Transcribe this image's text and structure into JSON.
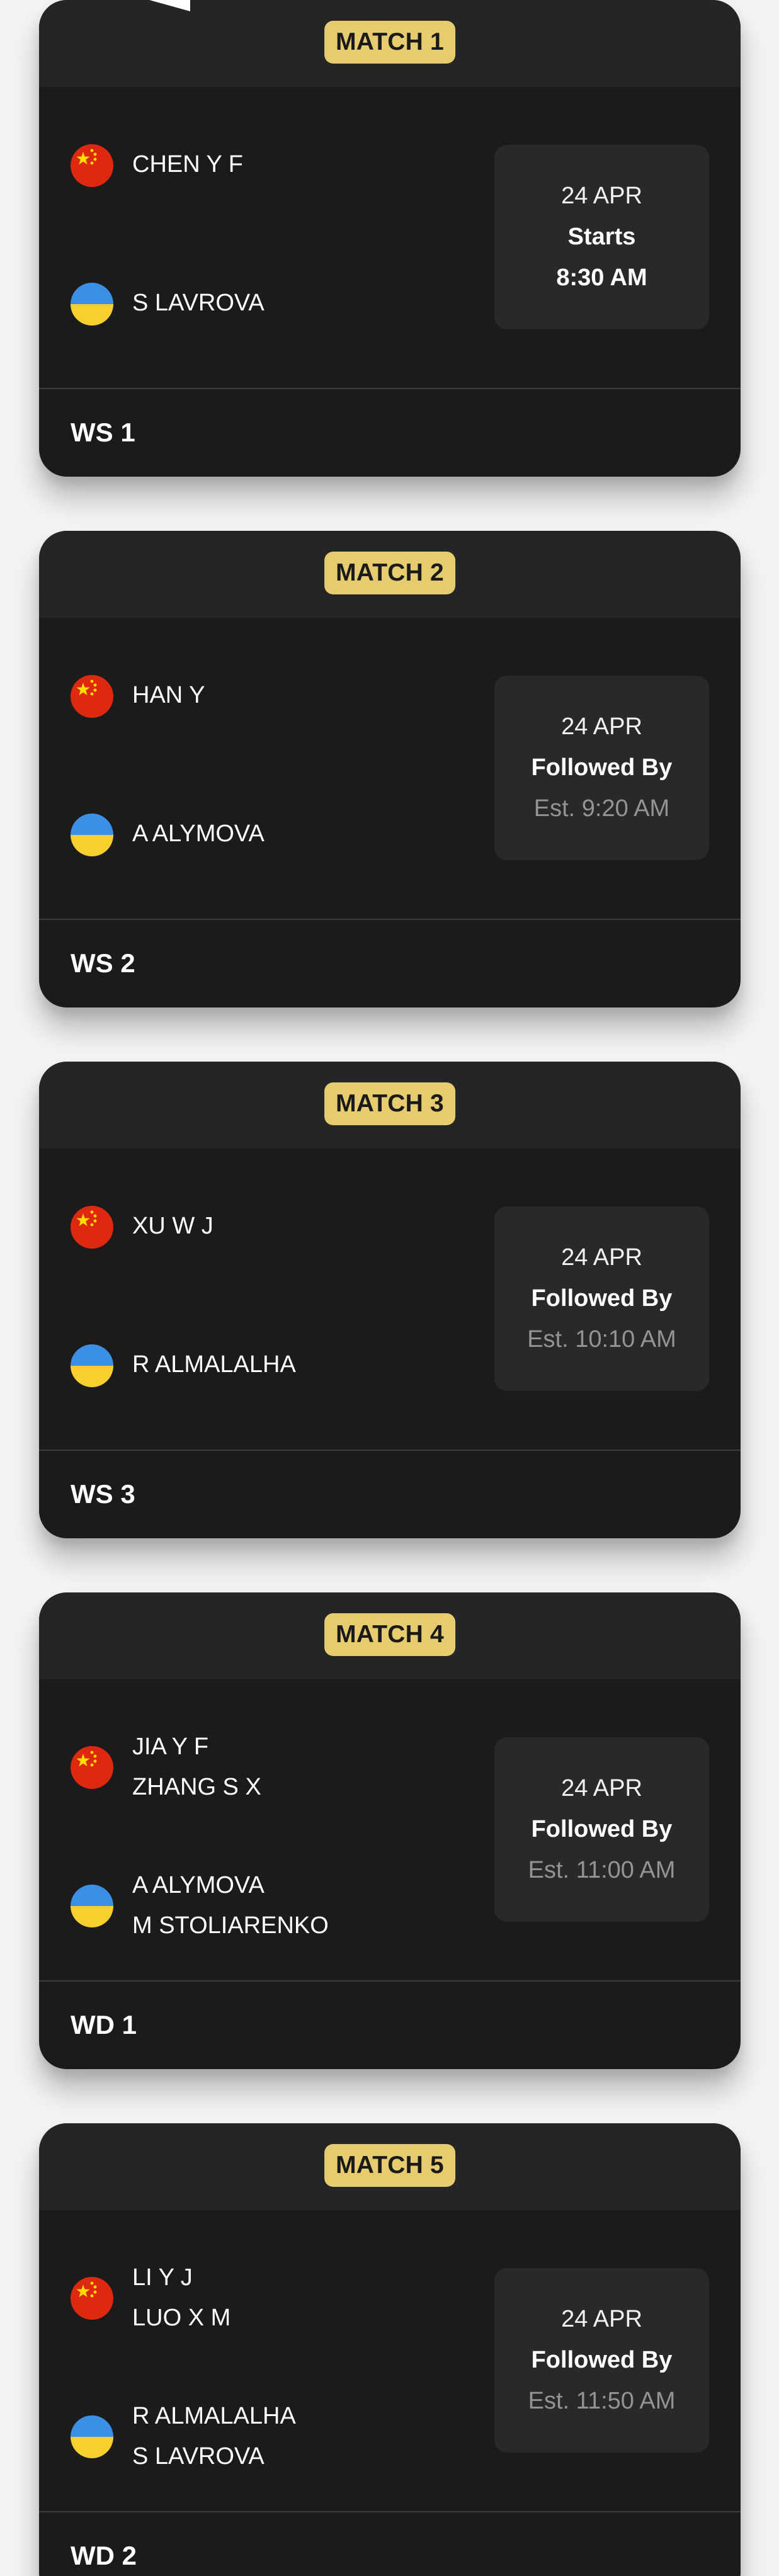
{
  "colors": {
    "card_background": "#1b1b1c",
    "card_header": "#252526",
    "badge": "#e7cc6f",
    "schedule_box": "#29292a",
    "muted_text": "#949494"
  },
  "matches": [
    {
      "label": "MATCH 1",
      "team1": {
        "flag": "china-flag-icon",
        "players": [
          "CHEN Y F"
        ]
      },
      "team2": {
        "flag": "ukraine-flag-icon",
        "players": [
          "S LAVROVA"
        ]
      },
      "date": "24 APR",
      "status": "Starts",
      "time": "8:30 AM",
      "event": "WS 1"
    },
    {
      "label": "MATCH 2",
      "team1": {
        "flag": "china-flag-icon",
        "players": [
          "HAN Y"
        ]
      },
      "team2": {
        "flag": "ukraine-flag-icon",
        "players": [
          "A ALYMOVA"
        ]
      },
      "date": "24 APR",
      "status": "Followed By",
      "time": "Est. 9:20 AM",
      "event": "WS 2"
    },
    {
      "label": "MATCH 3",
      "team1": {
        "flag": "china-flag-icon",
        "players": [
          "XU W J"
        ]
      },
      "team2": {
        "flag": "ukraine-flag-icon",
        "players": [
          "R ALMALALHA"
        ]
      },
      "date": "24 APR",
      "status": "Followed By",
      "time": "Est. 10:10 AM",
      "event": "WS 3"
    },
    {
      "label": "MATCH 4",
      "team1": {
        "flag": "china-flag-icon",
        "players": [
          "JIA Y F",
          "ZHANG S X"
        ]
      },
      "team2": {
        "flag": "ukraine-flag-icon",
        "players": [
          "A ALYMOVA",
          "M STOLIARENKO"
        ]
      },
      "date": "24 APR",
      "status": "Followed By",
      "time": "Est. 11:00 AM",
      "event": "WD 1"
    },
    {
      "label": "MATCH 5",
      "team1": {
        "flag": "china-flag-icon",
        "players": [
          "LI Y J",
          "LUO X M"
        ]
      },
      "team2": {
        "flag": "ukraine-flag-icon",
        "players": [
          "R ALMALALHA",
          "S LAVROVA"
        ]
      },
      "date": "24 APR",
      "status": "Followed By",
      "time": "Est. 11:50 AM",
      "event": "WD 2"
    }
  ]
}
